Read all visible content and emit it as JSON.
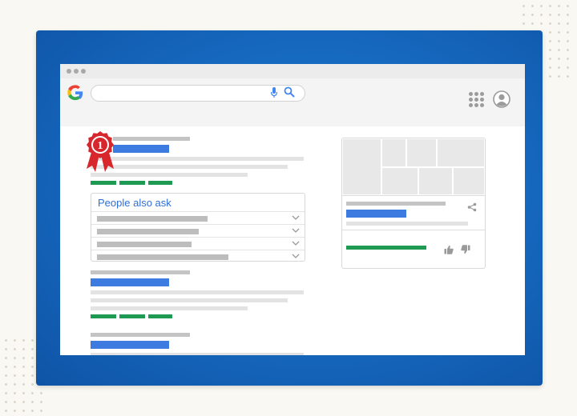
{
  "search": {
    "placeholder": "",
    "value": ""
  },
  "people_also_ask": {
    "title": "People also ask",
    "question_count": 4
  },
  "ranking_badge": {
    "rank": "1"
  },
  "colors": {
    "frame_blue": "#1567bd",
    "result_link_blue": "#3d7be0",
    "url_green": "#1f9a52",
    "badge_red": "#d8262d",
    "paa_title_blue": "#2f6fd6"
  },
  "icons": {
    "logo": "google-g-logo",
    "voice": "microphone-icon",
    "search": "magnifier-icon",
    "apps": "apps-grid-icon",
    "account": "account-circle-icon",
    "share": "share-icon",
    "like": "thumbs-up-icon",
    "dislike": "thumbs-down-icon",
    "expand": "chevron-down-icon",
    "badge": "rank-ribbon-icon"
  }
}
